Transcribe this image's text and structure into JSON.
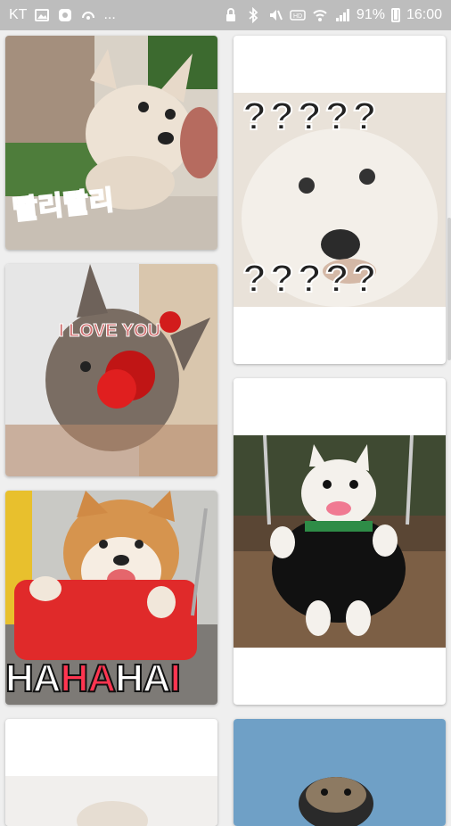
{
  "statusbar": {
    "carrier": "KT",
    "more": "...",
    "battery_percent": "91%",
    "time": "16:00",
    "icons": [
      "gallery-icon",
      "messenger-icon",
      "airplay-icon",
      "bluetooth-icon",
      "mute-icon",
      "hd-icon",
      "wifi-icon",
      "signal-icon",
      "battery-icon"
    ]
  },
  "stickers": {
    "korean_caption": "빨리빨리",
    "love_caption": "I LOVE YOU",
    "question_row": "?????",
    "haha_parts": [
      "HA",
      "HA",
      "HA",
      "I"
    ]
  },
  "colors": {
    "statusbar": "#bdbdbd",
    "background": "#efefef",
    "card": "#ffffff",
    "accent_red": "#ff3550"
  }
}
